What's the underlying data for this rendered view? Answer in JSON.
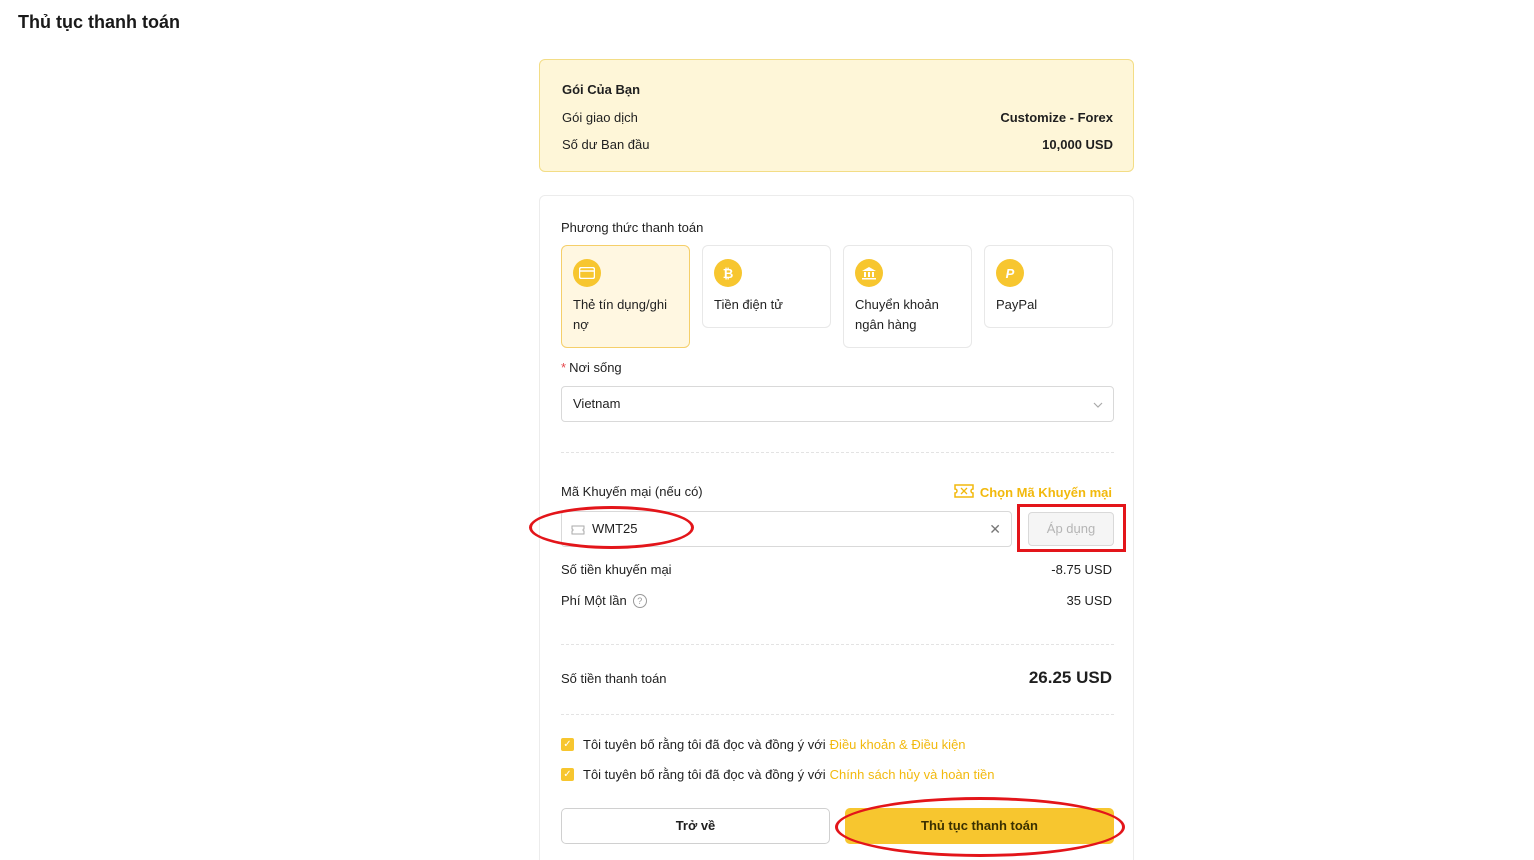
{
  "page": {
    "title": "Thủ tục thanh toán"
  },
  "summary": {
    "title": "Gói Của Bạn",
    "rows": [
      {
        "label": "Gói giao dịch",
        "value": "Customize - Forex"
      },
      {
        "label": "Số dư Ban đầu",
        "value": "10,000 USD"
      }
    ]
  },
  "payment": {
    "section_label": "Phương thức thanh toán",
    "methods": [
      {
        "label": "Thẻ tín dụng/ghi nợ",
        "icon": "credit-card-icon",
        "selected": true
      },
      {
        "label": "Tiền điện tử",
        "icon": "bitcoin-icon",
        "selected": false
      },
      {
        "label": "Chuyển khoản ngân hàng",
        "icon": "bank-icon",
        "selected": false
      },
      {
        "label": "PayPal",
        "icon": "paypal-icon",
        "selected": false
      }
    ],
    "residence": {
      "label": "Nơi sống",
      "required_mark": "*",
      "value": "Vietnam"
    },
    "promo": {
      "label": "Mã Khuyến mại (nếu có)",
      "choose_link": "Chọn Mã Khuyến mại",
      "value": "WMT25",
      "apply_label": "Áp dụng"
    },
    "discount": {
      "label": "Số tiền khuyến mại",
      "value": "-8.75 USD"
    },
    "fee": {
      "label": "Phí Một lần",
      "value": "35 USD"
    },
    "total": {
      "label": "Số tiền thanh toán",
      "value": "26.25 USD"
    },
    "agreements": [
      {
        "text": "Tôi tuyên bố rằng tôi đã đọc và đồng ý với",
        "link": "Điều khoản & Điều kiện",
        "checked": true
      },
      {
        "text": "Tôi tuyên bố rằng tôi đã đọc và đồng ý với",
        "link": "Chính sách hủy và hoàn tiền",
        "checked": true
      }
    ],
    "back_label": "Trở về",
    "submit_label": "Thủ tục thanh toán"
  },
  "colors": {
    "accent": "#f7c62f",
    "link": "#f2b90d",
    "annotation": "#e3151a",
    "summary_bg": "#fef6d8"
  }
}
